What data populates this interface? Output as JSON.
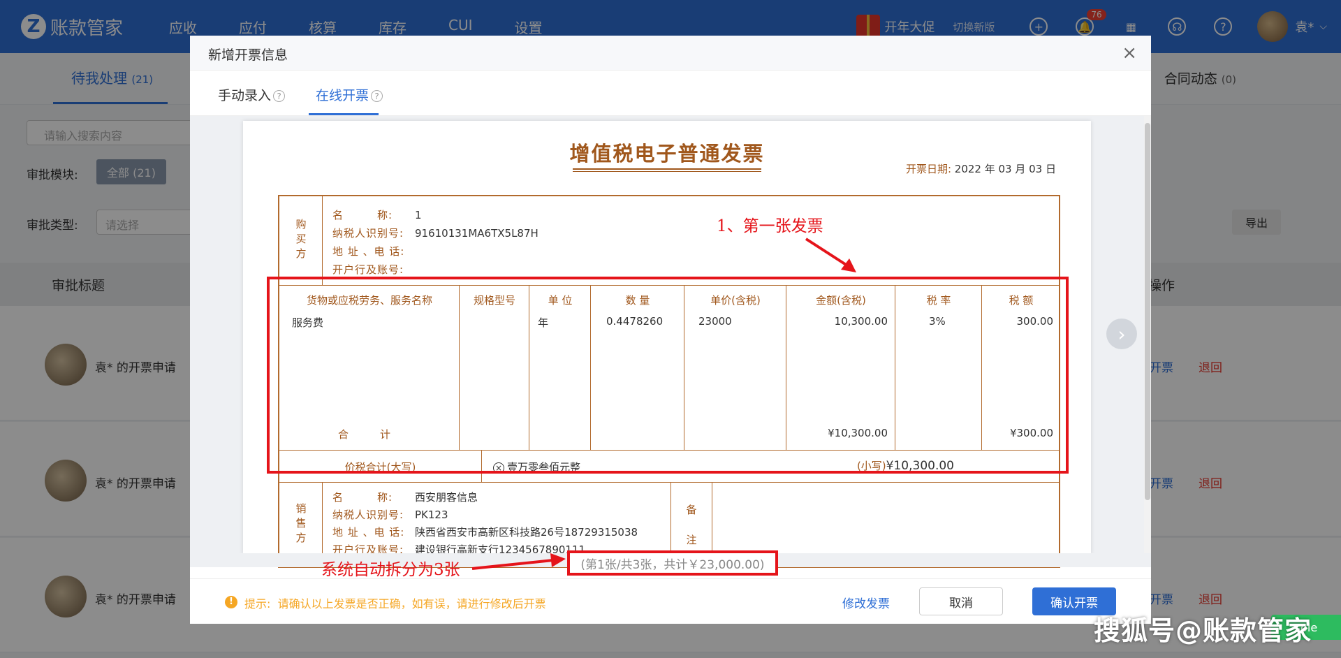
{
  "topbar": {
    "logo_text": "账款管家",
    "nav": [
      "应收",
      "应付",
      "核算",
      "库存",
      "CUI",
      "设置"
    ],
    "promo": "开年大促",
    "switch_version": "切换新版",
    "notification_count": "76",
    "user_name": "袁*"
  },
  "background": {
    "tab_pending": "待我处理",
    "tab_pending_count": "(21)",
    "tab_contract": "合同动态",
    "tab_contract_count": "(0)",
    "search_placeholder": "请输入搜索内容",
    "module_label": "审批模块:",
    "module_all": "全部 (21)",
    "type_label": "审批类型:",
    "type_placeholder": "请选择",
    "export": "导出",
    "col_title": "审批标题",
    "col_ops": "操作",
    "rows": [
      {
        "title": "袁* 的开票申请",
        "op1": "开票",
        "op2": "退回"
      },
      {
        "title": "袁* 的开票申请",
        "op1": "开票",
        "op2": "退回"
      },
      {
        "title": "袁* 的开票申请",
        "op1": "开票",
        "op2": "退回"
      }
    ],
    "console": "sole"
  },
  "modal": {
    "title": "新增开票信息",
    "tabs": [
      "手动录入",
      "在线开票"
    ],
    "active_tab": "在线开票"
  },
  "invoice": {
    "title": "增值税电子普通发票",
    "date_label": "开票日期:",
    "date_value": "2022 年 03 月 03 日",
    "buyer_label": "购买方",
    "buyer": {
      "name_k": "名　　　称:",
      "name_v": "1",
      "tax_k": "纳税人识别号:",
      "tax_v": "91610131MA6TX5L87H",
      "addr_k": "地 址 、电 话:",
      "addr_v": "",
      "bank_k": "开户行及账号:",
      "bank_v": ""
    },
    "goods_headers": [
      "货物或应税劳务、服务名称",
      "规格型号",
      "单 位",
      "数 量",
      "单价(含税)",
      "金额(含税)",
      "税 率",
      "税 额"
    ],
    "goods_row": [
      "服务费",
      "",
      "年",
      "0.4478260",
      "23000",
      "10,300.00",
      "3%",
      "300.00"
    ],
    "total_label": "合　　　计",
    "total_amount": "¥10,300.00",
    "total_tax": "¥300.00",
    "sum_label": "价税合计(大写)",
    "sum_upper": "壹万零叁佰元整",
    "sum_lower_label": "(小写)",
    "sum_lower": "¥10,300.00",
    "seller_label": "销售方",
    "seller": {
      "name_k": "名　　　称:",
      "name_v": "西安朋客信息",
      "tax_k": "纳税人识别号:",
      "tax_v": "PK123",
      "addr_k": "地 址 、电 话:",
      "addr_v": "陕西省西安市高新区科技路26号18729315038",
      "bank_k": "开户行及账号:",
      "bank_v": "建设银行高新支行1234567890111"
    },
    "remark_chars": [
      "备",
      "注"
    ]
  },
  "annotations": {
    "first_invoice": "1、第一张发票",
    "auto_split": "系统自动拆分为3张",
    "pager": "(第1张/共3张，共计￥23,000.00)"
  },
  "footer": {
    "tip_label": "提示:",
    "tip_text": "请确认以上发票是否正确，如有误，请进行修改后开票",
    "edit": "修改发票",
    "cancel": "取消",
    "confirm": "确认开票"
  },
  "watermark": "搜狐号@账款管家"
}
